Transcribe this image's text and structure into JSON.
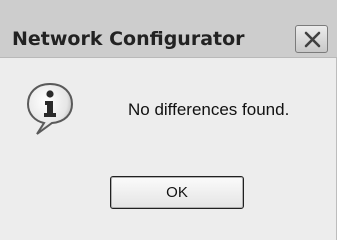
{
  "window": {
    "title": "Network Configurator",
    "close_icon": "close-x-icon"
  },
  "body": {
    "icon": "information-icon",
    "message": "No differences found."
  },
  "buttons": {
    "ok_label": "OK"
  }
}
